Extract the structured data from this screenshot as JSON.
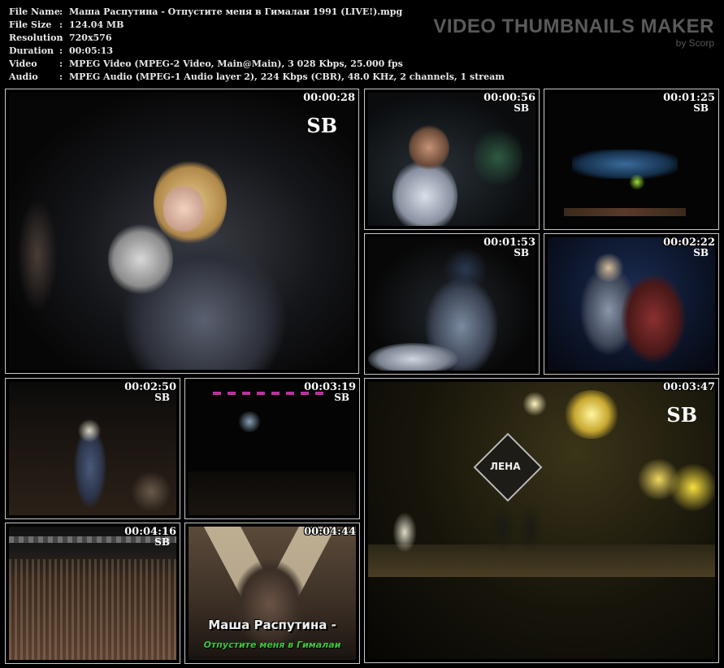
{
  "info": {
    "rows": [
      {
        "key": "File Name",
        "value": "Маша Распутина - Отпустите меня в Гималаи 1991 (LIVE!).mpg"
      },
      {
        "key": "File Size",
        "value": "124.04 MB"
      },
      {
        "key": "Resolution",
        "value": "720x576"
      },
      {
        "key": "Duration",
        "value": "00:05:13"
      },
      {
        "key": "Video",
        "value": "MPEG Video (MPEG-2 Video, Main@Main), 3 028 Kbps, 25.000 fps"
      },
      {
        "key": "Audio",
        "value": "MPEG Audio (MPEG-1 Audio layer 2), 224 Kbps (CBR), 48.0 KHz, 2 channels, 1 stream"
      }
    ]
  },
  "brand": {
    "title": "VIDEO THUMBNAILS MAKER",
    "subtitle": "by Scorp"
  },
  "watermark": "SB",
  "thumbnails": [
    {
      "time": "00:00:28"
    },
    {
      "time": "00:00:56"
    },
    {
      "time": "00:01:25"
    },
    {
      "time": "00:01:53"
    },
    {
      "time": "00:02:22"
    },
    {
      "time": "00:02:50"
    },
    {
      "time": "00:03:19"
    },
    {
      "time": "00:03:47"
    },
    {
      "time": "00:04:16"
    },
    {
      "time": "00:04:44"
    }
  ],
  "captions": {
    "artist": "Маша Распутина -",
    "song": "Отпустите меня в Гималаи"
  },
  "stage_sign": "ЛЕНА"
}
